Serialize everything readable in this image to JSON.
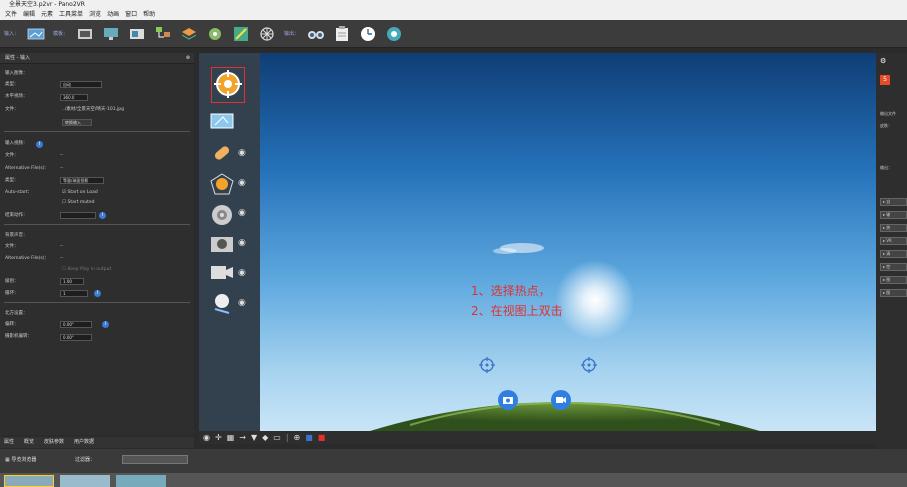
{
  "window": {
    "title": "全景天空3.p2vr - Pano2VR"
  },
  "menu": [
    "文件",
    "编辑",
    "元素",
    "工具菜单",
    "浏览",
    "动画",
    "窗口",
    "帮助"
  ],
  "toolbar": {
    "input_label": "输入：",
    "output_label": "输出："
  },
  "left_panel": {
    "title": "属性 - 输入",
    "input_image": {
      "header": "输入图像：",
      "type_label": "类型：",
      "type_value": "自动",
      "hfov_label": "水平视场：",
      "hfov_value": "360.0",
      "file_label": "文件：",
      "file_value": "../素材/全景天空/晴天-101.jpg",
      "convert_button": "转换输入"
    },
    "input_video": {
      "header": "输入视频：",
      "file_label": "文件：",
      "file_value": "--",
      "alt_label": "Alternative File(s)：",
      "alt_value": "--",
      "type_label": "类型：",
      "type_value": "等量/球面投影",
      "autostart_label": "Auto-start：",
      "start_on_load": "Start on Load",
      "start_muted": "Start muted",
      "end_label": "结束动作：",
      "end_value": ""
    },
    "background_sound": {
      "header": "背景声音：",
      "file_label": "文件：",
      "file_value": "--",
      "alt_label": "Alternative File(s)：",
      "alt_value": "--",
      "keep_play": "Keep Play in output",
      "level_label": "级别：",
      "level_value": "1.00",
      "loop_label": "循环：",
      "loop_value": "1"
    },
    "north": {
      "header": "北方设置：",
      "heading_label": "偏转：",
      "heading_value": "0.00°",
      "offset_label": "摄影机偏转：",
      "offset_value": "0.00°"
    }
  },
  "left_tabs": [
    "属性",
    "概览",
    "皮肤参数",
    "用户数据"
  ],
  "bottom": {
    "tour_label": "导览浏览器",
    "filter_label": "过滤器："
  },
  "right_panel": {
    "items": [
      "输出文件",
      "皮肤：",
      "输出："
    ],
    "buttons": [
      "自",
      "输",
      "热",
      "VR",
      "清",
      "控",
      "图",
      "图"
    ]
  },
  "annotation": {
    "line1": "1、选择热点，",
    "line2": "2、在视图上双击"
  },
  "colors": {
    "accent": "#e23030",
    "info": "#3a7bd5",
    "hotspot": "#3a73c9"
  }
}
